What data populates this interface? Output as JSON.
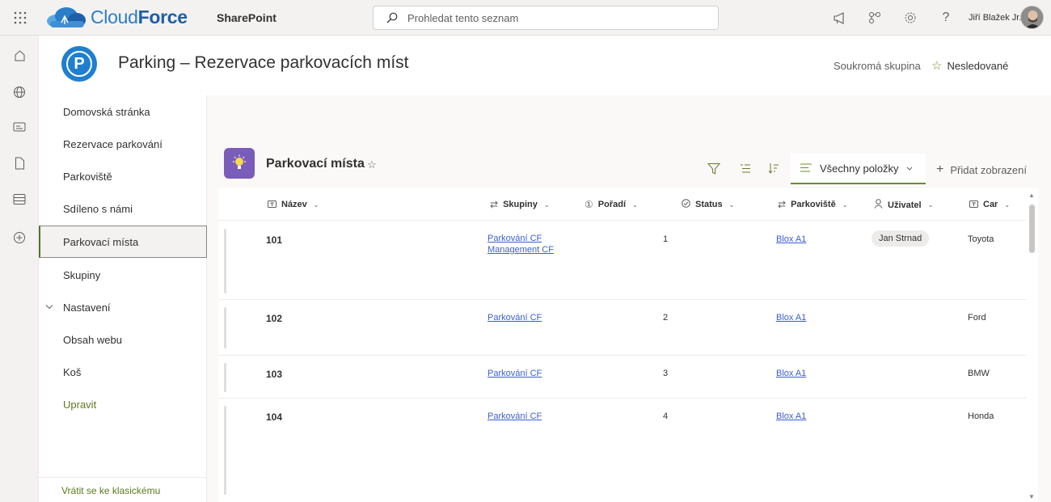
{
  "suite": {
    "brand_light": "Cloud",
    "brand_bold": "Force",
    "app_name": "SharePoint",
    "search_placeholder": "Prohledat tento seznam",
    "user_name": "Jiří Blažek Jr.",
    "icons": [
      "app-launcher-icon",
      "megaphone-icon",
      "share-icon",
      "settings-icon",
      "help-icon"
    ]
  },
  "site": {
    "logo_letter": "P",
    "title": "Parking – Rezervace parkovacích míst",
    "privacy": "Soukromá skupina",
    "follow_label": "Nesledované"
  },
  "nav": {
    "items": [
      {
        "label": "Domovská stránka"
      },
      {
        "label": "Rezervace parkování"
      },
      {
        "label": "Parkoviště"
      },
      {
        "label": "Sdíleno s námi"
      },
      {
        "label": "Parkovací místa",
        "selected": true
      },
      {
        "label": "Skupiny"
      },
      {
        "label": "Nastavení",
        "expandable": true
      },
      {
        "label": "Obsah webu"
      },
      {
        "label": "Koš"
      },
      {
        "label": "Upravit"
      }
    ],
    "classic_link": "Vrátit se ke klasickému"
  },
  "list": {
    "title": "Parkovací místa",
    "view_name": "Všechny položky",
    "add_view": "Přidat zobrazení",
    "columns": [
      "Název",
      "Skupiny",
      "Pořadí",
      "Status",
      "Parkoviště",
      "Uživatel",
      "Car"
    ],
    "rows": [
      {
        "name": "101",
        "groups": [
          "Parkování CF",
          "Management CF"
        ],
        "order": "1",
        "status": "",
        "parking": "Blox A1",
        "user": "Jan Strnad",
        "car": "Toyota"
      },
      {
        "name": "102",
        "groups": [
          "Parkování CF"
        ],
        "order": "2",
        "status": "",
        "parking": "Blox A1",
        "user": "",
        "car": "Ford"
      },
      {
        "name": "103",
        "groups": [
          "Parkování CF"
        ],
        "order": "3",
        "status": "",
        "parking": "Blox A1",
        "user": "",
        "car": "BMW"
      },
      {
        "name": "104",
        "groups": [
          "Parkování CF"
        ],
        "order": "4",
        "status": "",
        "parking": "Blox A1",
        "user": "",
        "car": "Honda"
      }
    ]
  },
  "colors": {
    "accent": "#6b8e23",
    "brand_blue": "#2c7ec9",
    "list_icon": "#7a5cb9",
    "link": "#3b5ed6"
  }
}
